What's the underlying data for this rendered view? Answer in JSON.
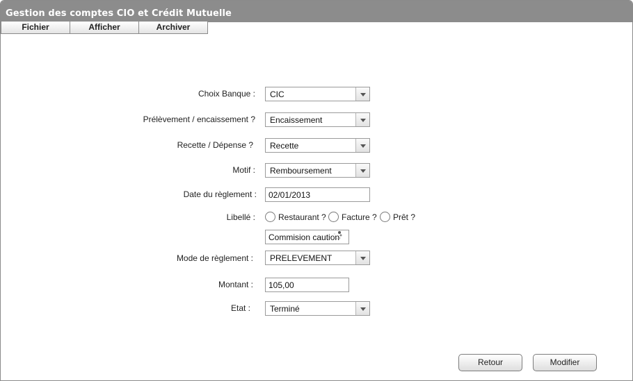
{
  "window": {
    "title": "Gestion des comptes CIO et Crédit Mutuelle"
  },
  "menu": {
    "items": [
      "Fichier",
      "Afficher",
      "Archiver"
    ]
  },
  "form": {
    "bank": {
      "label": "Choix Banque :",
      "value": "CIC"
    },
    "debit_credit": {
      "label": "Prélèvement / encaissement ?",
      "value": "Encaissement"
    },
    "income_expense": {
      "label": "Recette / Dépense ?",
      "value": "Recette"
    },
    "reason": {
      "label": "Motif :",
      "value": "Remboursement"
    },
    "payment_date": {
      "label": "Date du règlement :",
      "value": "02/01/2013"
    },
    "wording": {
      "label": "Libellé :",
      "options": [
        "Restaurant ?",
        "Facture ?",
        "Prêt ?"
      ],
      "text_value": "Commision caution"
    },
    "payment_method": {
      "label": "Mode de règlement :",
      "value": "PRELEVEMENT"
    },
    "amount": {
      "label": "Montant :",
      "value": "105,00"
    },
    "status": {
      "label": "Etat :",
      "value": "Terminé"
    }
  },
  "buttons": {
    "back": "Retour",
    "modify": "Modifier"
  }
}
